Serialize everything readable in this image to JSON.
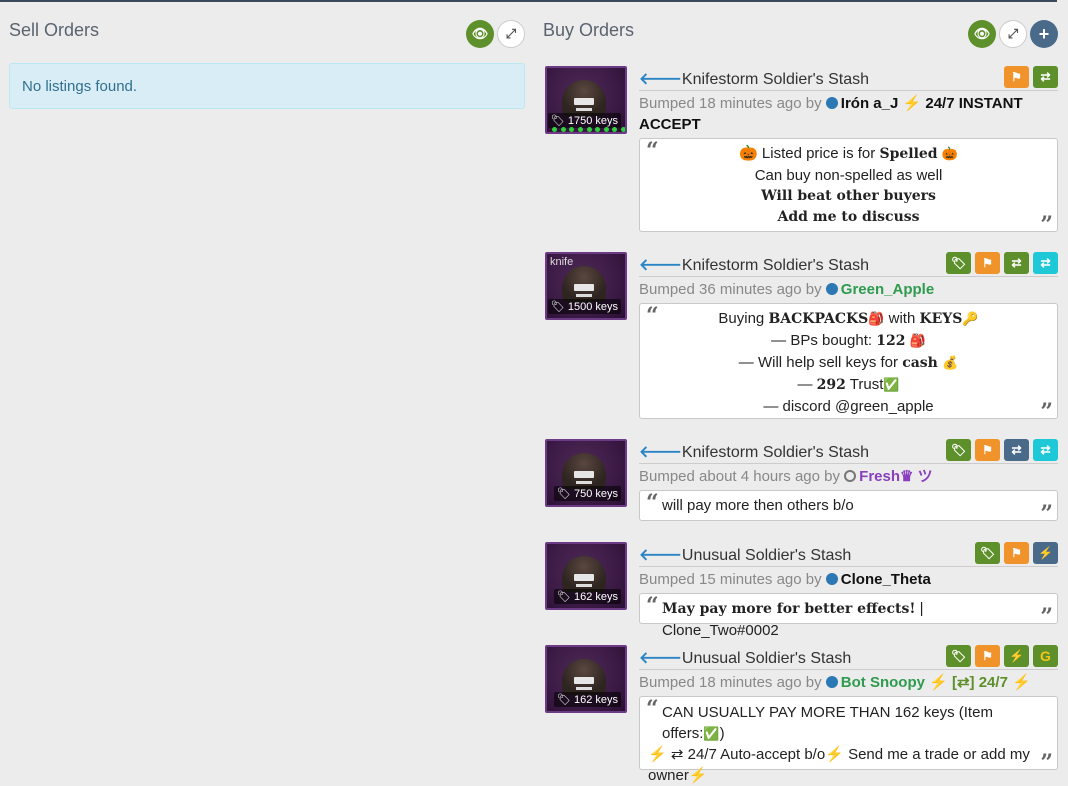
{
  "sell": {
    "title": "Sell Orders",
    "empty": "No listings found."
  },
  "buy": {
    "title": "Buy Orders"
  },
  "orders": [
    {
      "title": "Knifestorm Soldier's Stash",
      "price": "1750 keys",
      "bumped": "Bumped 18 minutes ago by",
      "user": "Irón a_J",
      "suffix1": "24/7 INSTANT",
      "suffix2": "ACCEPT",
      "lines": [
        "🎃 Listed price is for",
        "Spelled",
        "🎃",
        "Can buy non-spelled as well",
        "Will beat other buyers",
        "Add me to discuss"
      ]
    },
    {
      "title": "Knifestorm Soldier's Stash",
      "price": "1500 keys",
      "tag": "knife",
      "bumped": "Bumped 36 minutes ago by",
      "user": "Green_Apple",
      "lines": [
        "Buying",
        "BACKPACKS",
        "🎒",
        "with",
        "KEYS",
        "🔑",
        "— BPs bought:",
        "122",
        "🎒",
        "— Will help sell keys for",
        "cash",
        "💰",
        "—",
        "292",
        "Trust",
        "✅",
        "— discord @green_apple"
      ]
    },
    {
      "title": "Knifestorm Soldier's Stash",
      "price": "750 keys",
      "bumped": "Bumped about 4 hours ago by",
      "user": "Fresh♛ ツ",
      "message": "will pay more then others b/o"
    },
    {
      "title": "Unusual Soldier's Stash",
      "price": "162 keys",
      "bumped": "Bumped 15 minutes ago by",
      "user": "Clone_Theta",
      "msg_bold": "May pay more for better effects!",
      "msg_rest": " | Clone_Two#0002"
    },
    {
      "title": "Unusual Soldier's Stash",
      "price": "162 keys",
      "bumped": "Bumped 18 minutes ago by",
      "user": "Bot Snoopy",
      "suffix1": "[⇄] 24/7",
      "line1": "CAN USUALLY PAY MORE THAN 162 keys (Item offers:",
      "line1b": ")",
      "line2": "⇄ 24/7 Auto-accept b/o",
      "line2b": "Send me a trade or add my",
      "line3": "owner"
    }
  ],
  "colors": {
    "accent": "#2a84c5",
    "green": "#5d8f2a",
    "orange": "#f0932b",
    "slate": "#4a6a8a",
    "cyan": "#1fc8d6",
    "user_green": "#2e9b4f",
    "user_purple": "#8a3fbf"
  }
}
